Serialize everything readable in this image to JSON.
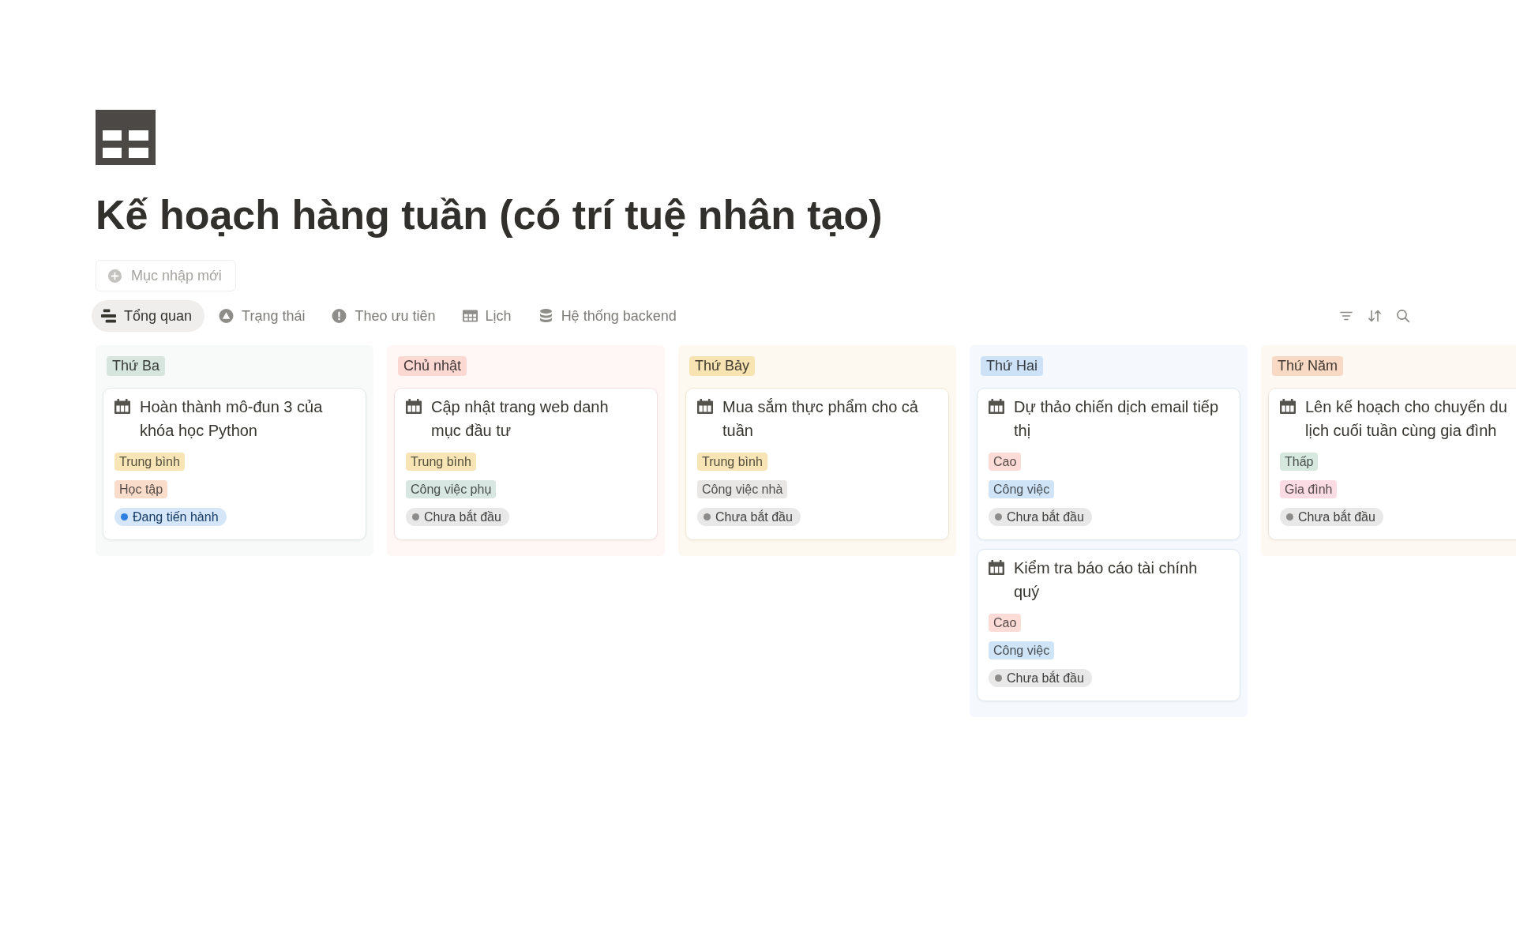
{
  "page": {
    "title": "Kế hoạch hàng tuần (có trí tuệ nhân tạo)"
  },
  "new_entry_button": {
    "label": "Mục nhập mới"
  },
  "view_tabs": [
    {
      "label": "Tổng quan",
      "selected": true
    },
    {
      "label": "Trạng thái",
      "selected": false
    },
    {
      "label": "Theo ưu tiên",
      "selected": false
    },
    {
      "label": "Lịch",
      "selected": false
    },
    {
      "label": "Hệ thống backend",
      "selected": false
    }
  ],
  "board": {
    "groups": [
      {
        "label": "Thứ Ba",
        "color": "#d6e6de",
        "cards": [
          {
            "title": "Hoàn thành mô-đun 3 của khóa học Python",
            "tags": [
              {
                "kind": "tag",
                "label": "Trung bình",
                "color": "#f8e5b6"
              },
              {
                "kind": "tag",
                "label": "Học tập",
                "color": "#fadccb"
              },
              {
                "kind": "status",
                "label": "Đang tiến hành",
                "color": "#2f80e0"
              }
            ]
          }
        ]
      },
      {
        "label": "Chủ nhật",
        "color": "#fcd8d2",
        "cards": [
          {
            "title": "Cập nhật trang web danh mục đầu tư",
            "tags": [
              {
                "kind": "tag",
                "label": "Trung bình",
                "color": "#f8e5b6"
              },
              {
                "kind": "tag",
                "label": "Công việc phụ",
                "color": "#d8e7e1"
              },
              {
                "kind": "status",
                "label": "Chưa bắt đầu",
                "color": "#8e8c8a"
              }
            ]
          }
        ]
      },
      {
        "label": "Thứ Bảy",
        "color": "#f8e3b2",
        "cards": [
          {
            "title": "Mua sắm thực phẩm cho cả tuần",
            "tags": [
              {
                "kind": "tag",
                "label": "Trung bình",
                "color": "#f8e5b6"
              },
              {
                "kind": "tag",
                "label": "Công việc nhà",
                "color": "#e9e7e6"
              },
              {
                "kind": "status",
                "label": "Chưa bắt đầu",
                "color": "#8e8c8a"
              }
            ]
          }
        ]
      },
      {
        "label": "Thứ Hai",
        "color": "#cde2f7",
        "cards": [
          {
            "title": "Dự thảo chiến dịch email tiếp thị",
            "tags": [
              {
                "kind": "tag",
                "label": "Cao",
                "color": "#fddbd6"
              },
              {
                "kind": "tag",
                "label": "Công việc",
                "color": "#d0e4f8"
              },
              {
                "kind": "status",
                "label": "Chưa bắt đầu",
                "color": "#8e8c8a"
              }
            ]
          },
          {
            "title": "Kiểm tra báo cáo tài chính quý",
            "tags": [
              {
                "kind": "tag",
                "label": "Cao",
                "color": "#fddbd6"
              },
              {
                "kind": "tag",
                "label": "Công việc",
                "color": "#d0e4f8"
              },
              {
                "kind": "status",
                "label": "Chưa bắt đầu",
                "color": "#8e8c8a"
              }
            ]
          }
        ]
      },
      {
        "label": "Thứ Năm",
        "color": "#f8dac4",
        "cards": [
          {
            "title": "Lên kế hoạch cho chuyến du lịch cuối tuần cùng gia đình",
            "tags": [
              {
                "kind": "tag",
                "label": "Thấp",
                "color": "#d7e9de"
              },
              {
                "kind": "tag",
                "label": "Gia đình",
                "color": "#fbdbe4"
              },
              {
                "kind": "status",
                "label": "Chưa bắt đầu",
                "color": "#8e8c8a"
              }
            ]
          }
        ]
      }
    ]
  }
}
